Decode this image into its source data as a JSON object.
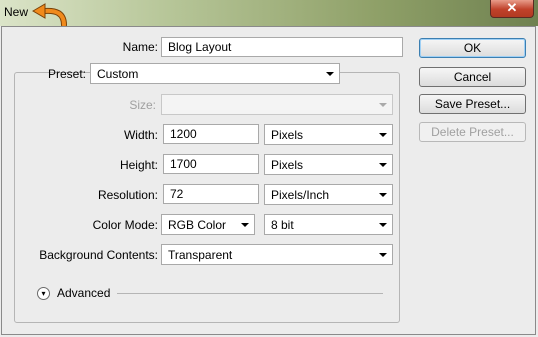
{
  "window": {
    "title": "New",
    "close_label": "✕"
  },
  "form": {
    "name": {
      "label": "Name:",
      "value": "Blog Layout"
    },
    "preset": {
      "label": "Preset:",
      "value": "Custom"
    },
    "size": {
      "label": "Size:",
      "value": ""
    },
    "width": {
      "label": "Width:",
      "value": "1200",
      "unit": "Pixels"
    },
    "height": {
      "label": "Height:",
      "value": "1700",
      "unit": "Pixels"
    },
    "resolution": {
      "label": "Resolution:",
      "value": "72",
      "unit": "Pixels/Inch"
    },
    "color_mode": {
      "label": "Color Mode:",
      "value": "RGB Color",
      "depth": "8 bit"
    },
    "background": {
      "label": "Background Contents:",
      "value": "Transparent"
    },
    "advanced": {
      "label": "Advanced"
    }
  },
  "buttons": {
    "ok": "OK",
    "cancel": "Cancel",
    "save_preset": "Save Preset...",
    "delete_preset": "Delete Preset..."
  },
  "icons": {
    "back_arrow": "curved-arrow-left-icon",
    "advanced_toggle": "chevron-double-down-icon"
  },
  "colors": {
    "arrow": "#f08a1c",
    "close": "#c0412a",
    "ok_border": "#3c7fb1"
  }
}
